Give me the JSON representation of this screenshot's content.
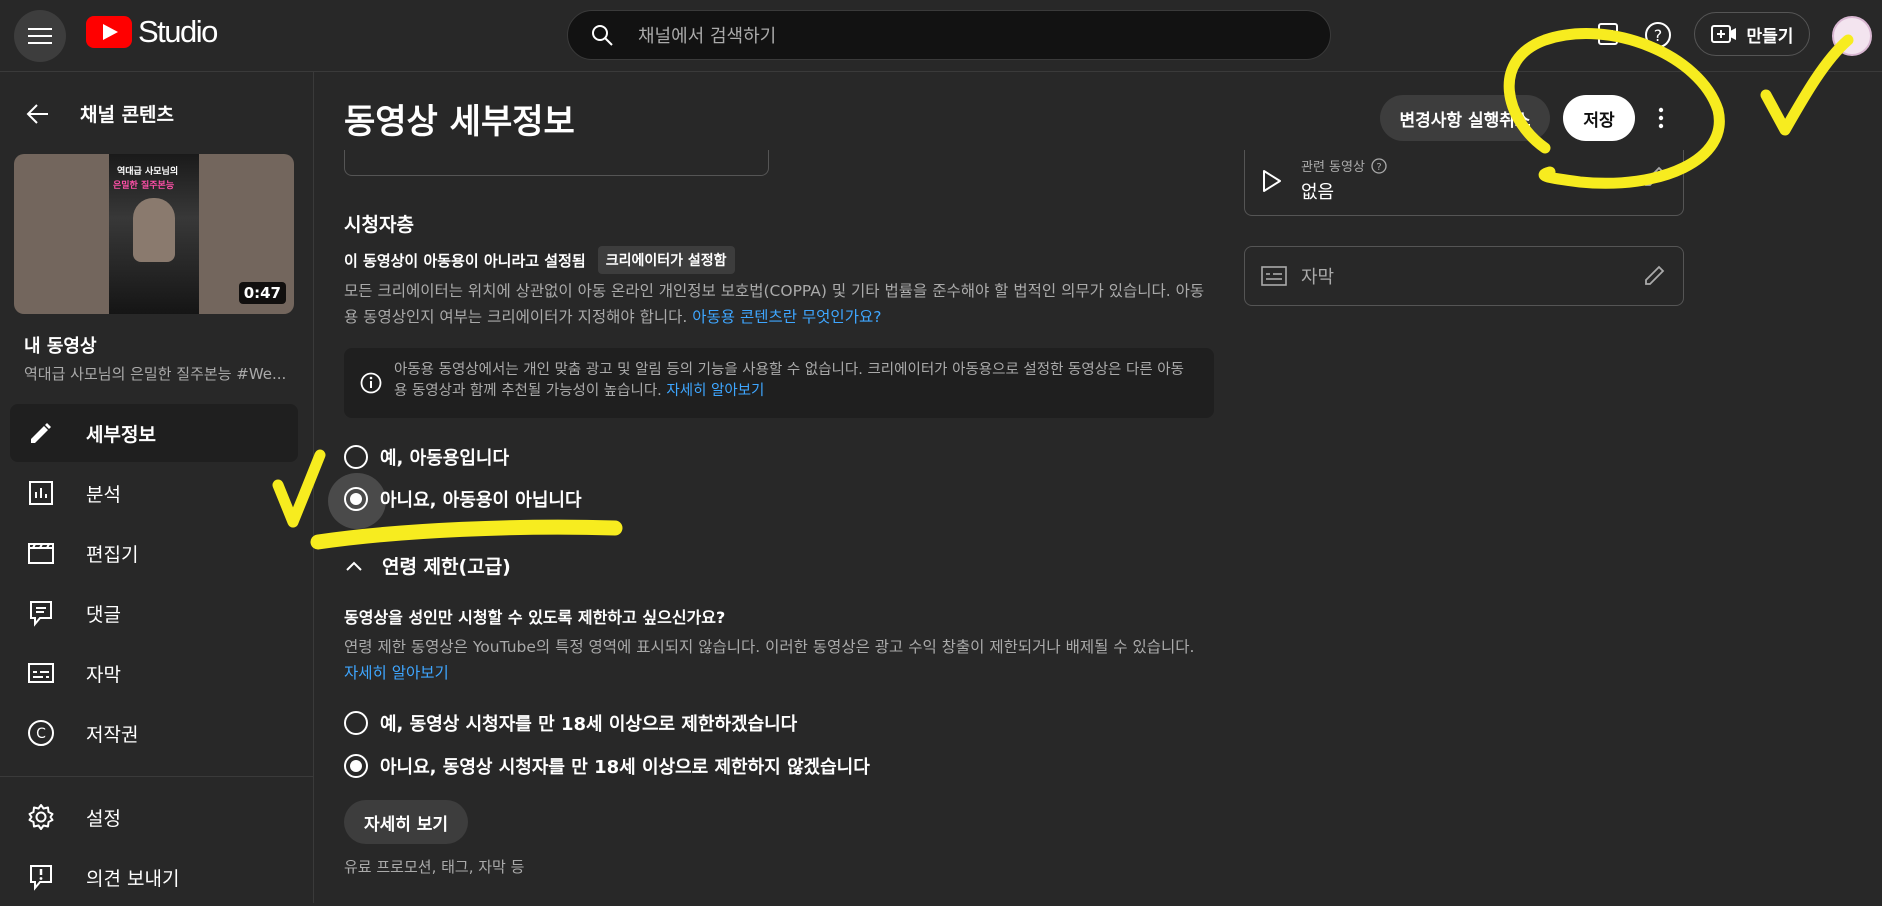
{
  "app": {
    "name": "Studio"
  },
  "search": {
    "placeholder": "채널에서 검색하기"
  },
  "header": {
    "create_label": "만들기"
  },
  "sidebar": {
    "back_label": "채널 콘텐츠",
    "thumbnail": {
      "duration": "0:47",
      "caption_line1": "역대급 사모님의",
      "caption_line2": "은밀한 질주본능"
    },
    "video_title": "내 동영상",
    "video_subtitle": "역대급 사모님의 은밀한 질주본능 #We...",
    "items": [
      {
        "label": "세부정보",
        "icon": "pencil-icon"
      },
      {
        "label": "분석",
        "icon": "analytics-icon"
      },
      {
        "label": "편집기",
        "icon": "clapperboard-icon"
      },
      {
        "label": "댓글",
        "icon": "comment-icon"
      },
      {
        "label": "자막",
        "icon": "subtitles-icon"
      },
      {
        "label": "저작권",
        "icon": "copyright-icon"
      },
      {
        "label": "설정",
        "icon": "gear-icon"
      },
      {
        "label": "의견 보내기",
        "icon": "feedback-icon"
      }
    ]
  },
  "main": {
    "title": "동영상 세부정보",
    "undo_label": "변경사항 실행취소",
    "save_label": "저장",
    "audience": {
      "title": "시청자층",
      "status": "이 동영상이 아동용이 아니라고 설정됨",
      "chip": "크리에이터가 설정함",
      "description": "모든 크리에이터는 위치에 상관없이 아동 온라인 개인정보 보호법(COPPA) 및 기타 법률을 준수해야 할 법적인 의무가 있습니다. 아동용 동영상인지 여부는 크리에이터가 지정해야 합니다.",
      "link": "아동용 콘텐츠란 무엇인가요?",
      "info": "아동용 동영상에서는 개인 맞춤 광고 및 알림 등의 기능을 사용할 수 없습니다. 크리에이터가 아동용으로 설정한 동영상은 다른 아동용 동영상과 함께 추천될 가능성이 높습니다.",
      "info_link": "자세히 알아보기",
      "option_yes": "예, 아동용입니다",
      "option_no": "아니요, 아동용이 아닙니다",
      "selected": "no"
    },
    "age": {
      "toggle_label": "연령 제한(고급)",
      "question": "동영상을 성인만 시청할 수 있도록 제한하고 싶으신가요?",
      "description": "연령 제한 동영상은 YouTube의 특정 영역에 표시되지 않습니다. 이러한 동영상은 광고 수익 창출이 제한되거나 배제될 수 있습니다.",
      "link": "자세히 알아보기",
      "option_yes": "예, 동영상 시청자를 만 18세 이상으로 제한하겠습니다",
      "option_no": "아니요, 동영상 시청자를 만 18세 이상으로 제한하지 않겠습니다",
      "selected": "no"
    },
    "more": {
      "button_label": "자세히 보기",
      "subtitle": "유료 프로모션, 태그, 자막 등"
    }
  },
  "right": {
    "related": {
      "label": "관련 동영상",
      "value": "없음"
    },
    "captions": {
      "label": "자막"
    }
  },
  "colors": {
    "accent_link": "#3ea6ff",
    "brand_red": "#ff0000",
    "annotation_yellow": "#f7ec1f"
  }
}
